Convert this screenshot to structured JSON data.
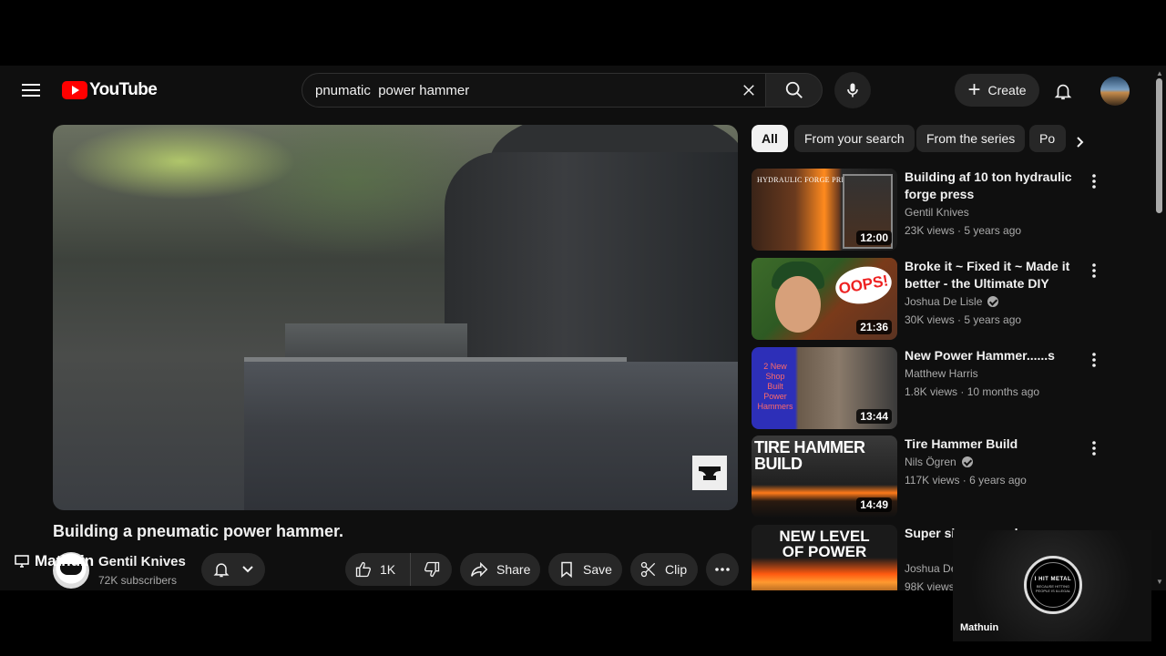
{
  "header": {
    "logo_text": "YouTube",
    "search_value": "pnumatic  power hammer",
    "create_label": "Create"
  },
  "video": {
    "title": "Building a pneumatic power hammer.",
    "channel_name": "Gentil Knives",
    "subscribers": "72K subscribers",
    "likes": "1K",
    "share_label": "Share",
    "save_label": "Save",
    "clip_label": "Clip"
  },
  "mini_player_label": "Mathuin",
  "chips": [
    "All",
    "From your search",
    "From the series",
    "Po"
  ],
  "related": [
    {
      "title": "Building af 10 ton hydraulic forge press",
      "channel": "Gentil Knives",
      "verified": false,
      "meta": "23K views · 5 years ago",
      "duration": "12:00",
      "thumb_text": "HYDRAULIC FORGE PRESS"
    },
    {
      "title": "Broke it ~ Fixed it ~ Made it better - the Ultimate DIY Powe...",
      "channel": "Joshua De Lisle",
      "verified": true,
      "meta": "30K views · 5 years ago",
      "duration": "21:36",
      "thumb_text": "OOPS!"
    },
    {
      "title": "New Power Hammer......s",
      "channel": "Matthew Harris",
      "verified": false,
      "meta": "1.8K views · 10 months ago",
      "duration": "13:44",
      "thumb_text": "2 New Shop Built Power Hammers"
    },
    {
      "title": "Tire Hammer Build",
      "channel": "Nils Ögren",
      "verified": true,
      "meta": "117K views · 6 years ago",
      "duration": "14:49",
      "thumb_text": "TIRE HAMMER BUILD"
    },
    {
      "title": "Super sir... power ha...",
      "channel": "Joshua De...",
      "verified": false,
      "meta": "98K views",
      "duration": "",
      "thumb_text": "NEW LEVEL OF POWER"
    }
  ],
  "overlay": {
    "name": "Mathuin",
    "logo_text": "I HIT METAL",
    "logo_tagline": "BECAUSE HITTING PEOPLE IS ILLEGAL"
  },
  "icons": {
    "menu": "hamburger-icon",
    "search": "search-icon",
    "clear": "close-icon",
    "mic": "microphone-icon",
    "bell": "bell-icon",
    "like": "thumbs-up-icon",
    "dislike": "thumbs-down-icon",
    "share": "share-arrow-icon",
    "save": "bookmark-icon",
    "clip": "scissors-icon",
    "more": "more-horizontal-icon"
  },
  "colors": {
    "brand": "#ff0000",
    "background": "#0f0f0f",
    "surface": "#272727",
    "text": "#f1f1f1",
    "muted": "#aaaaaa"
  }
}
